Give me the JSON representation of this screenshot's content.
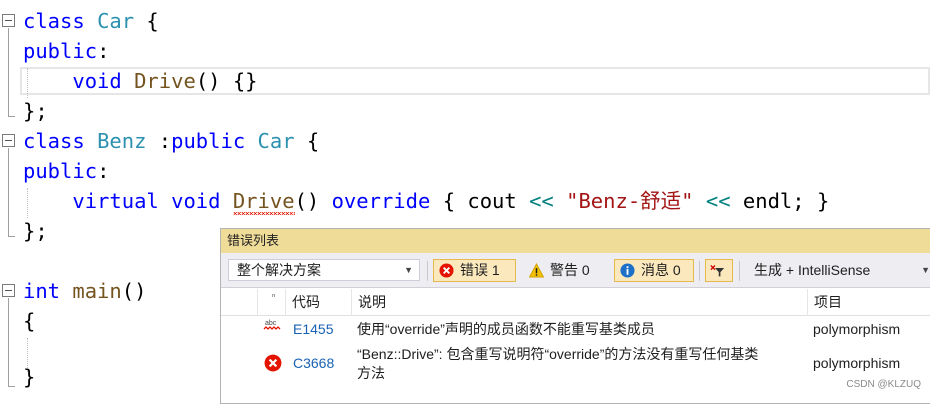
{
  "editor": {
    "lines": {
      "l1": {
        "kw": "class",
        "name": "Car",
        "rest": " {"
      },
      "l2": {
        "kw": "public",
        "rest": ":"
      },
      "l3": {
        "kw": "void",
        "fn": "Drive",
        "rest": "() {}"
      },
      "l4": {
        "rest": "};"
      },
      "l5": {
        "kw": "class",
        "name": "Benz",
        "kw2": "public",
        "base": "Car",
        "rest": " {"
      },
      "l6": {
        "kw": "public",
        "rest": ":"
      },
      "l7": {
        "kw": "virtual",
        "kw2": "void",
        "fn": "Drive",
        "paren": "()",
        "kw3": "override",
        "brace": "{",
        "id": "cout",
        "op": "<<",
        "str": "\"Benz-舒适\"",
        "op2": "<<",
        "id2": "endl",
        "tail": "; }"
      },
      "l8": {
        "rest": "};"
      },
      "l9": {
        "kw": "int",
        "fn": "main",
        "rest": "()"
      },
      "l10": {
        "rest": "{"
      },
      "l11": {
        "rest": "}"
      }
    }
  },
  "error_list": {
    "title": "错误列表",
    "scope": "整个解决方案",
    "errors_label": "错误 1",
    "warnings_label": "警告 0",
    "messages_label": "消息 0",
    "build_filter": "生成 + IntelliSense",
    "columns": {
      "code": "代码",
      "description": "说明",
      "project": "项目"
    },
    "rows": [
      {
        "icon": "intellisense-squiggle-icon",
        "code": "E1455",
        "description": "使用“override”声明的成员函数不能重写基类成员",
        "project": "polymorphism"
      },
      {
        "icon": "error-icon",
        "code": "C3668",
        "description_line1": "“Benz::Drive”: 包含重写说明符“override”的方法没有重写任何基类",
        "description_line2": "方法",
        "project": "polymorphism"
      }
    ]
  },
  "watermark": "CSDN @KLZUQ",
  "colors": {
    "keyword": "#0000ff",
    "type": "#2b91af",
    "string": "#a31515",
    "error": "#e51400",
    "panel_title": "#f0dc99"
  }
}
